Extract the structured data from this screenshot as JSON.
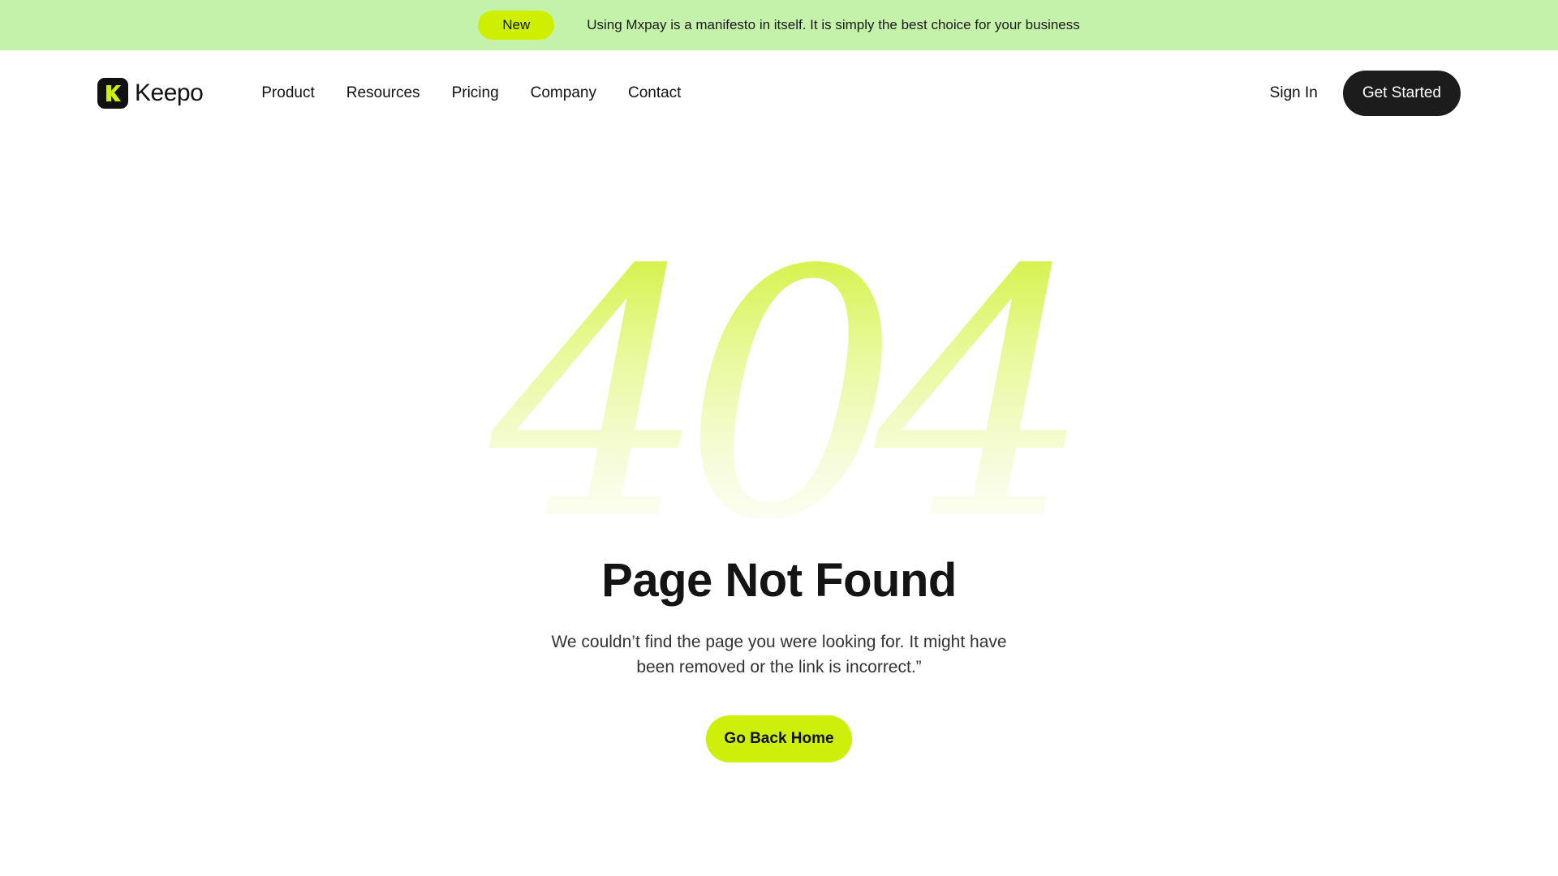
{
  "announcement": {
    "badge": "New",
    "text": "Using Mxpay is a manifesto in itself. It is simply the best choice for your business"
  },
  "header": {
    "logo_text": "Keepo",
    "logo_icon": "k-logo-icon",
    "nav": [
      "Product",
      "Resources",
      "Pricing",
      "Company",
      "Contact"
    ],
    "signin_label": "Sign In",
    "cta_label": "Get Started"
  },
  "main": {
    "code": "404",
    "title": "Page Not Found",
    "description": "We couldn’t find the page you were looking for. It might have been removed or the link is incorrect.”",
    "button_label": "Go Back Home"
  },
  "colors": {
    "announcement_bg": "#c5f2aa",
    "accent": "#cdef09",
    "dark": "#1c1c1c"
  }
}
